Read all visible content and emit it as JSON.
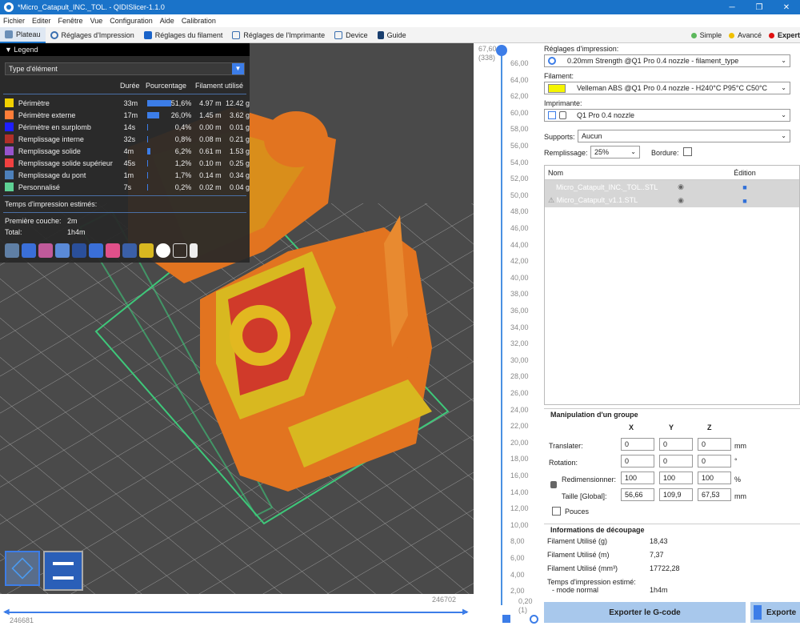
{
  "window": {
    "title": "*Micro_Catapult_INC._TOL. - QIDISlicer-1.1.0",
    "controls": [
      "─",
      "❐",
      "✕"
    ]
  },
  "menu": [
    "Fichier",
    "Editer",
    "Fenêtre",
    "Vue",
    "Configuration",
    "Aide",
    "Calibration"
  ],
  "tabs": [
    {
      "label": "Plateau",
      "active": true
    },
    {
      "label": "Réglages d'Impression"
    },
    {
      "label": "Réglages du filament"
    },
    {
      "label": "Réglages de l'Imprimante"
    },
    {
      "label": "Device"
    },
    {
      "label": "Guide"
    }
  ],
  "modes": [
    {
      "label": "Simple",
      "color": "#5cb85c"
    },
    {
      "label": "Avancé",
      "color": "#f0c000"
    },
    {
      "label": "Expert",
      "color": "#e01010"
    }
  ],
  "legend": {
    "title": "Legend",
    "type_label": "Type d'élément",
    "columns": {
      "time": "Durée",
      "pct": "Pourcentage",
      "used": "Filament utilisé"
    },
    "rows": [
      {
        "name": "Périmètre",
        "color": "#f0d000",
        "time": "33m",
        "pct": "51,6%",
        "pct_value": 51.6,
        "m": "4.97 m",
        "g": "12.42 g"
      },
      {
        "name": "Périmètre externe",
        "color": "#ff7d38",
        "time": "17m",
        "pct": "26,0%",
        "pct_value": 26.0,
        "m": "1.45 m",
        "g": "3.62 g"
      },
      {
        "name": "Périmètre en surplomb",
        "color": "#1f1fff",
        "time": "14s",
        "pct": "0,4%",
        "pct_value": 0.4,
        "m": "0.00 m",
        "g": "0.01 g"
      },
      {
        "name": "Remplissage interne",
        "color": "#b03029",
        "time": "32s",
        "pct": "0,8%",
        "pct_value": 0.8,
        "m": "0.08 m",
        "g": "0.21 g"
      },
      {
        "name": "Remplissage solide",
        "color": "#9654cc",
        "time": "4m",
        "pct": "6,2%",
        "pct_value": 6.2,
        "m": "0.61 m",
        "g": "1.53 g"
      },
      {
        "name": "Remplissage solide supérieur",
        "color": "#f04040",
        "time": "45s",
        "pct": "1,2%",
        "pct_value": 1.2,
        "m": "0.10 m",
        "g": "0.25 g"
      },
      {
        "name": "Remplissage du pont",
        "color": "#4d80ba",
        "time": "1m",
        "pct": "1,7%",
        "pct_value": 1.7,
        "m": "0.14 m",
        "g": "0.34 g"
      },
      {
        "name": "Personnalisé",
        "color": "#5ed194",
        "time": "7s",
        "pct": "0,2%",
        "pct_value": 0.2,
        "m": "0.02 m",
        "g": "0.04 g"
      }
    ],
    "estimated_label": "Temps d'impression estimés:",
    "first_layer_label": "Première couche:",
    "first_layer_value": "2m",
    "total_label": "Total:",
    "total_value": "1h4m"
  },
  "ruler": {
    "top_value": "67,60",
    "top_layer": "(338)",
    "bottom_value": "0,20",
    "bottom_layer": "(1)",
    "ticks": [
      "66,00",
      "64,00",
      "62,00",
      "60,00",
      "58,00",
      "56,00",
      "54,00",
      "52,00",
      "50,00",
      "48,00",
      "46,00",
      "44,00",
      "42,00",
      "40,00",
      "38,00",
      "36,00",
      "34,00",
      "32,00",
      "30,00",
      "28,00",
      "26,00",
      "24,00",
      "22,00",
      "20,00",
      "18,00",
      "16,00",
      "14,00",
      "12,00",
      "10,00",
      "8,00",
      "6,00",
      "4,00",
      "2,00"
    ]
  },
  "hscroll": {
    "left_value": "246681",
    "right_value": "246702"
  },
  "panel": {
    "print_settings_label": "Réglages d'impression:",
    "print_settings_value": "0.20mm Strength @Q1 Pro 0.4 nozzle - filament_type",
    "filament_label": "Filament:",
    "filament_value": "Velleman ABS @Q1 Pro 0.4 nozzle - H240°C P95°C C50°C",
    "filament_color": "#f5f500",
    "printer_label": "Imprimante:",
    "printer_value": "Q1 Pro 0.4 nozzle",
    "supports_label": "Supports:",
    "supports_value": "Aucun",
    "infill_label": "Remplissage:",
    "infill_value": "25%",
    "brim_label": "Bordure:",
    "objects_header_name": "Nom",
    "objects_header_edit": "Édition",
    "objects": [
      {
        "name": "Micro_Catapult_INC._TOL..STL"
      },
      {
        "name": "Micro_Catapult_v1.1.STL"
      }
    ],
    "manip_title": "Manipulation d'un groupe",
    "axes": [
      "X",
      "Y",
      "Z"
    ],
    "translate_label": "Translater:",
    "translate": [
      "0",
      "0",
      "0"
    ],
    "translate_unit": "mm",
    "rotation_label": "Rotation:",
    "rotation": [
      "0",
      "0",
      "0"
    ],
    "rotation_unit": "°",
    "scale_label": "Redimensionner:",
    "scale": [
      "100",
      "100",
      "100"
    ],
    "scale_unit": "%",
    "size_label": "Taille [Global]:",
    "size": [
      "56,66",
      "109,9",
      "67,53"
    ],
    "size_unit": "mm",
    "inches_label": "Pouces",
    "slice_title": "Informations de découpage",
    "slice_rows": [
      {
        "label": "Filament Utilisé (g)",
        "value": "18,43"
      },
      {
        "label": "Filament Utilisé (m)",
        "value": "7,37"
      },
      {
        "label": "Filament Utilisé (mm³)",
        "value": "17722,28"
      }
    ],
    "est_label": "Temps d'impression estimé:",
    "mode_normal_label": "- mode normal",
    "mode_normal_value": "1h4m",
    "export_gcode": "Exporter le G-code",
    "export_short": "Exporte"
  }
}
